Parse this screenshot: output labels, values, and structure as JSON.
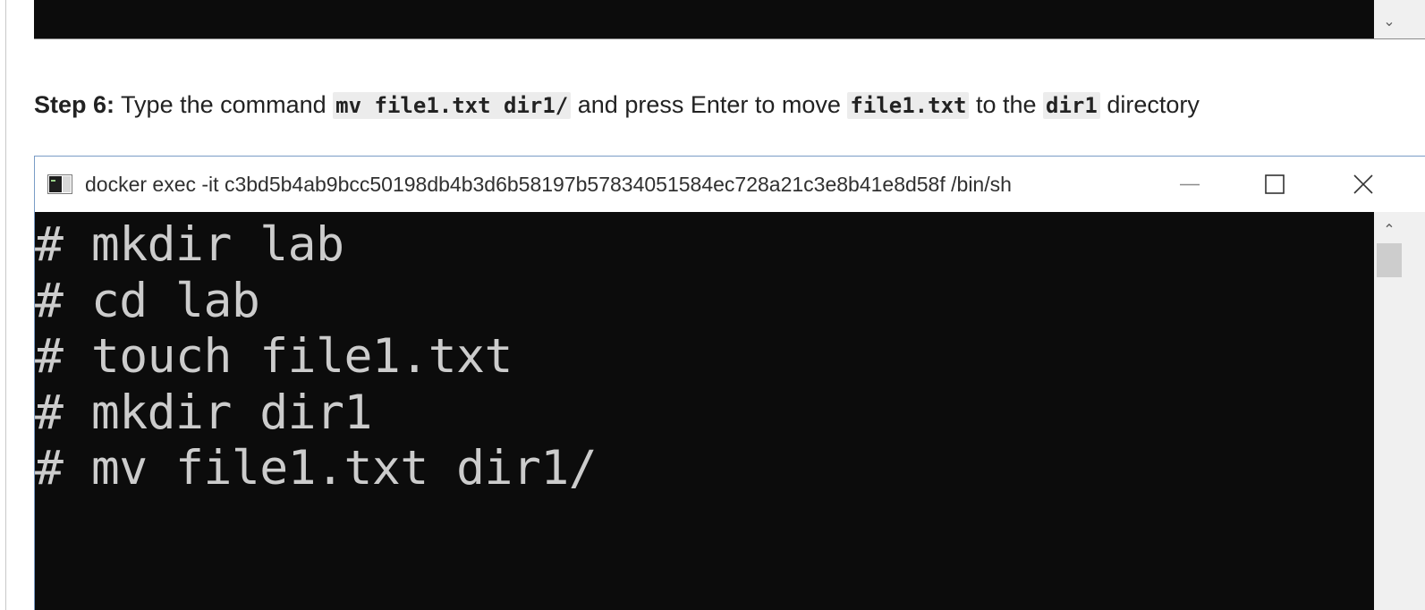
{
  "previous_terminal": {
    "scroll_down_glyph": "⌄"
  },
  "step": {
    "label": "Step 6:",
    "text_1": " Type the command ",
    "command": "mv file1.txt dir1/",
    "text_2": " and press Enter to move ",
    "file": "file1.txt",
    "text_3": " to the ",
    "directory": "dir1",
    "text_4": " directory"
  },
  "terminal": {
    "title": "docker  exec -it c3bd5b4ab9bcc50198db4b3d6b58197b57834051584ec728a21c3e8b41e8d58f /bin/sh",
    "lines": [
      "# mkdir lab",
      "# cd lab",
      "# touch file1.txt",
      "# mkdir dir1",
      "# mv file1.txt dir1/"
    ],
    "scroll_up_glyph": "⌃"
  },
  "icons": {
    "app": "console-window-icon",
    "minimize": "minimize-icon",
    "maximize": "maximize-icon",
    "close": "close-icon"
  },
  "colors": {
    "terminal_background": "#0c0c0c",
    "terminal_text": "#cccccc",
    "window_border": "#7a9cc6"
  }
}
